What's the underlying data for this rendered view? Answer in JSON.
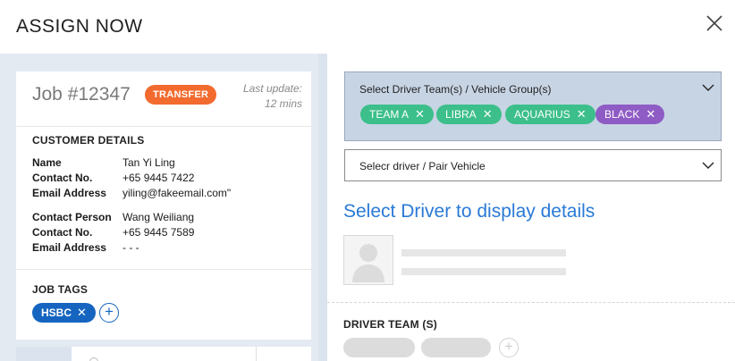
{
  "modal": {
    "title": "ASSIGN NOW",
    "close_icon": "close-icon"
  },
  "job": {
    "id_label": "Job #12347",
    "type_badge": "TRANSFER",
    "last_update_label": "Last update:",
    "last_update_value": "12 mins",
    "badge_color": "#f26a2e"
  },
  "customer": {
    "section_title": "CUSTOMER DETAILS",
    "rows": [
      {
        "label": "Name",
        "value": "Tan Yi Ling"
      },
      {
        "label": "Contact No.",
        "value": "+65 9445 7422"
      },
      {
        "label": "Email Address",
        "value": "yiling@fakeemail.com\""
      }
    ],
    "contact_rows": [
      {
        "label": "Contact Person",
        "value": "Wang Weiliang"
      },
      {
        "label": "Contact No.",
        "value": "+65 9445 7589"
      },
      {
        "label": "Email Address",
        "value": "- - -"
      }
    ]
  },
  "job_tags": {
    "section_title": "JOB TAGS",
    "tags": [
      {
        "label": "HSBC",
        "color": "#1565c0"
      }
    ],
    "add_icon": "plus-circle-icon"
  },
  "team_select": {
    "label": "Select Driver Team(s) / Vehicle Group(s)",
    "chips": [
      {
        "label": "TEAM A",
        "color": "#3cbf8a"
      },
      {
        "label": "LIBRA",
        "color": "#3cbf8a"
      },
      {
        "label": "AQUARIUS",
        "color": "#3cbf8a"
      },
      {
        "label": "BLACK",
        "color": "#8e5cc4"
      }
    ]
  },
  "driver_select": {
    "label": "Selecr driver / Pair Vehicle"
  },
  "driver_details": {
    "heading": "Select Driver to display details",
    "heading_color": "#2a7ad6",
    "avatar_icon": "user-placeholder-icon"
  },
  "driver_team": {
    "section_title": "DRIVER TEAM (S)"
  }
}
